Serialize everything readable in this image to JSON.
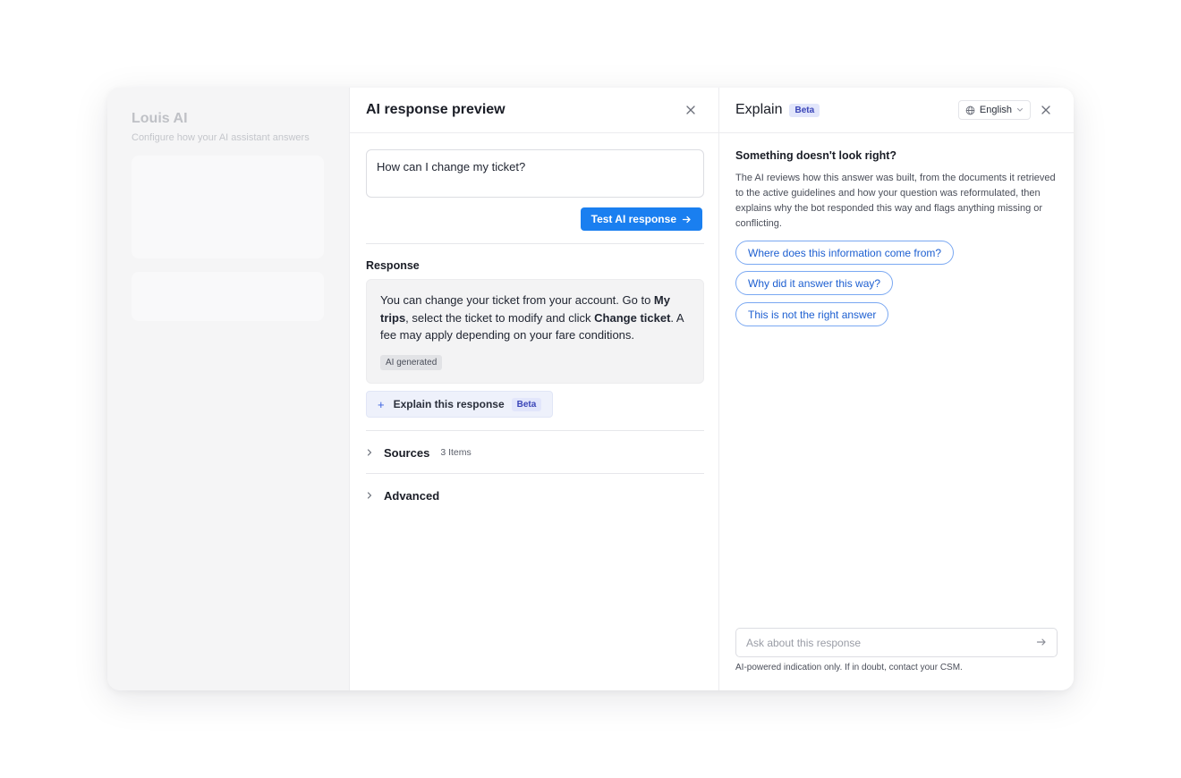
{
  "background_app": {
    "title": "Louis AI",
    "subtitle": "Configure how your AI assistant answers"
  },
  "preview_panel": {
    "title": "AI response preview",
    "question_value": "How can I change my ticket?",
    "test_button_label": "Test AI response",
    "response_label": "Response",
    "response_segments": [
      {
        "text": "You can change your ticket from your account. Go to ",
        "bold": false
      },
      {
        "text": "My trips",
        "bold": true
      },
      {
        "text": ", select the ticket to modify and click ",
        "bold": false
      },
      {
        "text": "Change ticket",
        "bold": true
      },
      {
        "text": ". A fee may apply depending on your fare conditions.",
        "bold": false
      }
    ],
    "ai_tag": "AI generated",
    "explain_button_label": "Explain this response",
    "explain_button_badge": "Beta",
    "sources_label": "Sources",
    "sources_count": "3 Items",
    "advanced_label": "Advanced"
  },
  "explain_panel": {
    "title": "Explain",
    "badge": "Beta",
    "language": "English",
    "heading": "Something doesn't look right?",
    "description": "The AI reviews how this answer was built, from the documents it retrieved to the active guidelines and how your question was reformulated, then explains why the bot responded this way and flags anything missing or conflicting.",
    "suggestions": [
      "Where does this information come from?",
      "Why did it answer this way?",
      "This is not the right answer"
    ],
    "ask_placeholder": "Ask about this response",
    "disclaimer": "AI-powered indication only. If in doubt, contact your CSM."
  },
  "colors": {
    "accent": "#1a7ff0",
    "chip_text": "#1d5fd1",
    "beta_bg": "#e2e6fb"
  },
  "icons": [
    "close-icon",
    "arrow-right-icon",
    "plus-icon",
    "chevron-right-icon",
    "globe-icon",
    "chevron-down-icon",
    "send-icon"
  ]
}
